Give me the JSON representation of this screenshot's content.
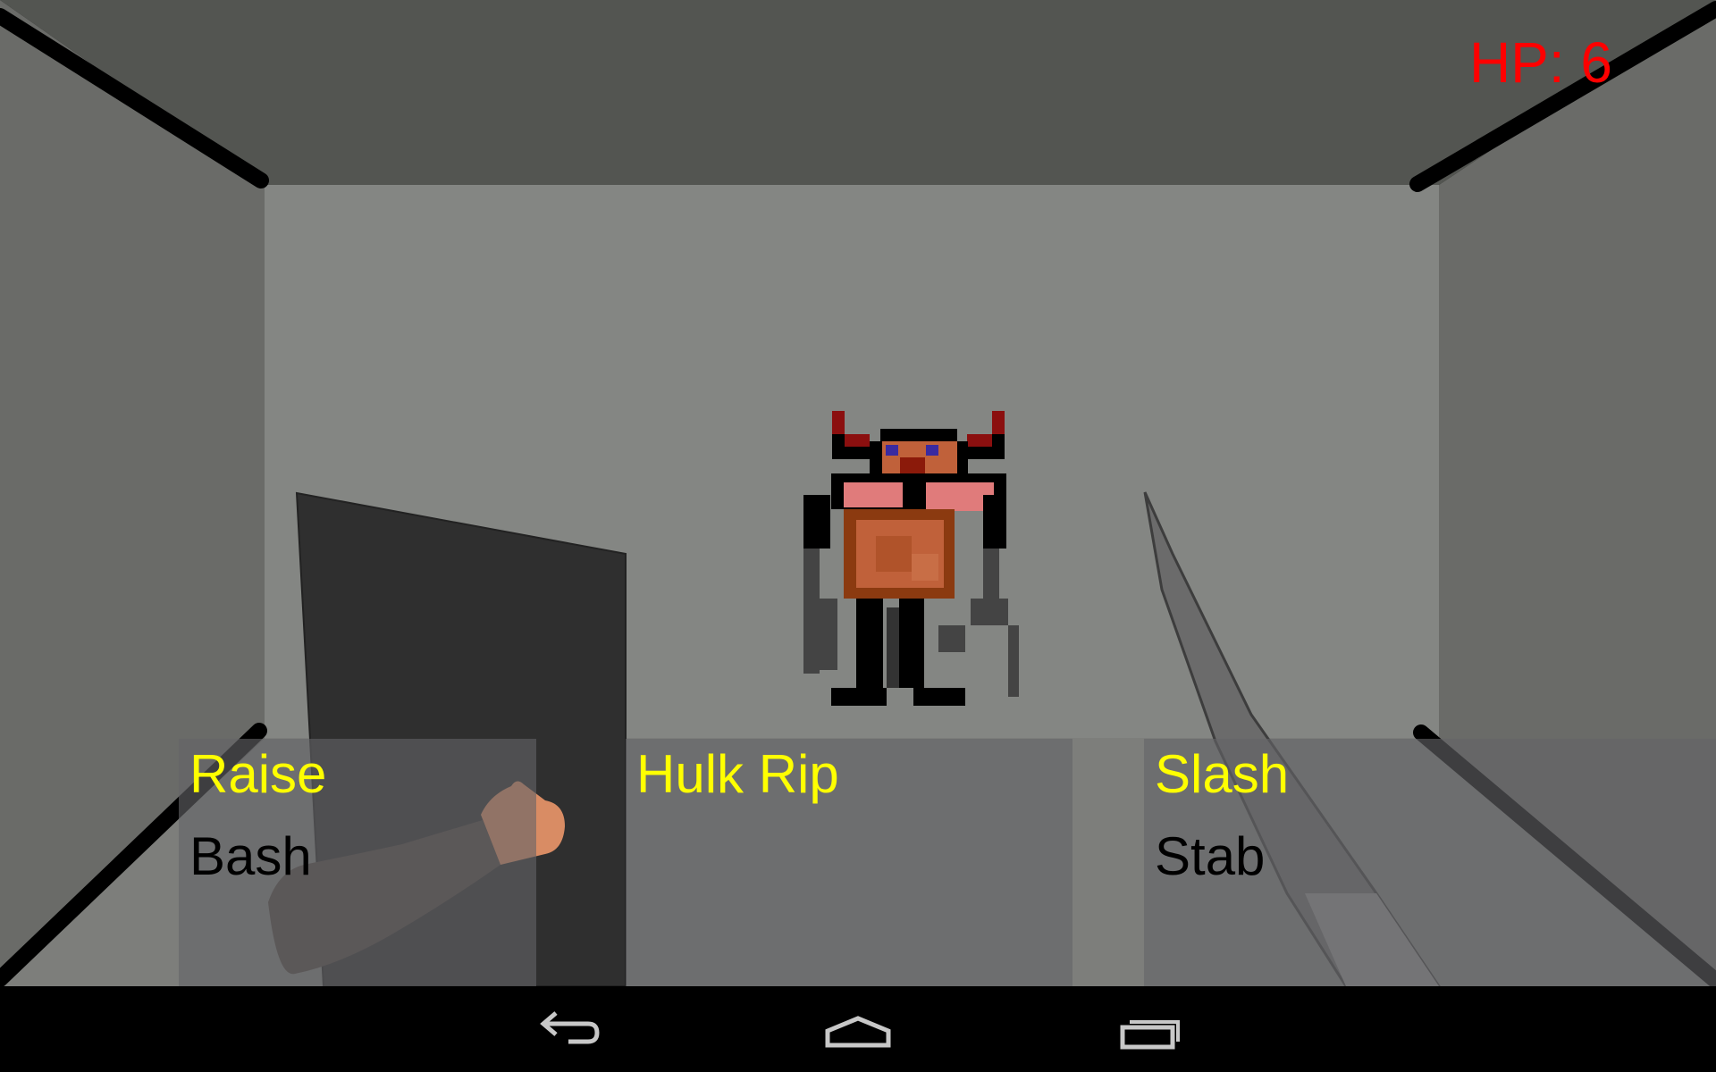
{
  "hud": {
    "hp_text": "HP: 6",
    "hp_color": "#ff0000"
  },
  "colors": {
    "ceiling": "#535551",
    "side_wall": "#6a6b68",
    "back_wall": "#848683",
    "floor": "#7d7e7b",
    "edge_lines": "#000000",
    "shield": "#2f2f2f",
    "sleeve": "#4e4440",
    "skin": "#d98c64",
    "blade": "#6b6b6b",
    "primary_label": "#ffff00",
    "secondary_label": "#000000",
    "panel": "#646468"
  },
  "actions": {
    "left": {
      "primary": "Raise",
      "secondary": "Bash"
    },
    "center": {
      "primary": "Hulk Rip"
    },
    "right": {
      "primary": "Slash",
      "secondary": "Stab"
    }
  },
  "enemy": {
    "kind": "horned-insect-monster"
  },
  "navbar": {
    "buttons": [
      {
        "name": "back-icon"
      },
      {
        "name": "home-icon"
      },
      {
        "name": "recent-apps-icon"
      }
    ]
  }
}
